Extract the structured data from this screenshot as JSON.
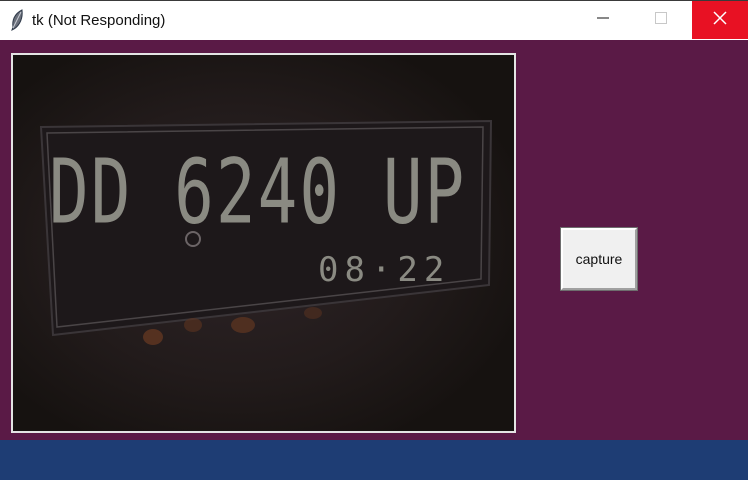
{
  "window": {
    "title": "tk (Not Responding)",
    "icon": "feather-icon",
    "controls": {
      "minimize": "minimize-icon",
      "maximize": "maximize-icon",
      "close": "close-icon"
    },
    "close_color": "#e81123",
    "background_color": "#5a1a46"
  },
  "camera_view": {
    "plate_text": "DD 6240 UP",
    "plate_expiry": "08·22"
  },
  "capture_button": {
    "label": "capture"
  },
  "taskbar": {
    "color": "#1e3d74"
  }
}
